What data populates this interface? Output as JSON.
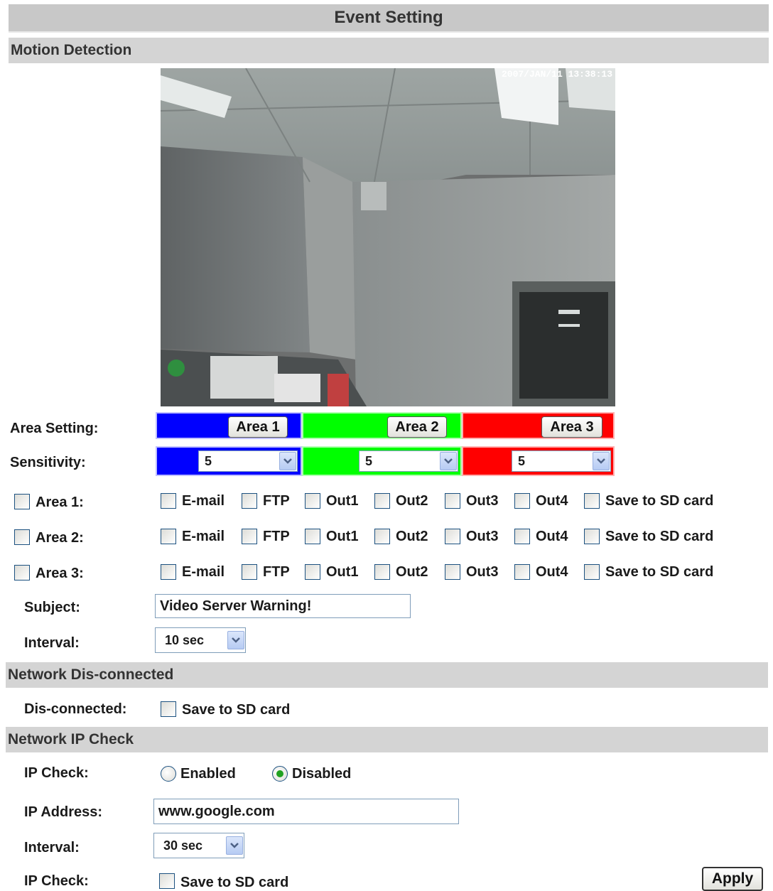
{
  "page_title": "Event Setting",
  "motion": {
    "section_title": "Motion Detection",
    "camera_timestamp": "2007/JAN/11 13:38:13",
    "area_setting_label": "Area Setting:",
    "sensitivity_label": "Sensitivity:",
    "areas": [
      {
        "button": "Area 1",
        "sensitivity": "5",
        "color": "#0000ff",
        "row_label": "Area 1:"
      },
      {
        "button": "Area 2",
        "sensitivity": "5",
        "color": "#00ff00",
        "row_label": "Area 2:"
      },
      {
        "button": "Area 3",
        "sensitivity": "5",
        "color": "#ff0000",
        "row_label": "Area 3:"
      }
    ],
    "actions": [
      "E-mail",
      "FTP",
      "Out1",
      "Out2",
      "Out3",
      "Out4",
      "Save to SD card"
    ],
    "subject_label": "Subject:",
    "subject_value": "Video Server Warning!",
    "interval_label": "Interval:",
    "interval_value": "10 sec"
  },
  "disconnect": {
    "section_title": "Network Dis-connected",
    "label": "Dis-connected:",
    "option": "Save to SD card"
  },
  "ipcheck": {
    "section_title": "Network IP Check",
    "label": "IP Check:",
    "enabled_label": "Enabled",
    "disabled_label": "Disabled",
    "selected": "Disabled",
    "address_label": "IP Address:",
    "address_value": "www.google.com",
    "interval_label": "Interval:",
    "interval_value": "30 sec",
    "save_label": "IP Check:",
    "save_option": "Save to SD card"
  },
  "apply_label": "Apply",
  "icons": {
    "dropdown": "chevron-down-icon",
    "checkbox": "checkbox",
    "radio": "radio"
  },
  "colors": {
    "section_bg": "#d4d4d4",
    "title_bg": "#c8c8c8",
    "selected_radio": "#21a121"
  }
}
